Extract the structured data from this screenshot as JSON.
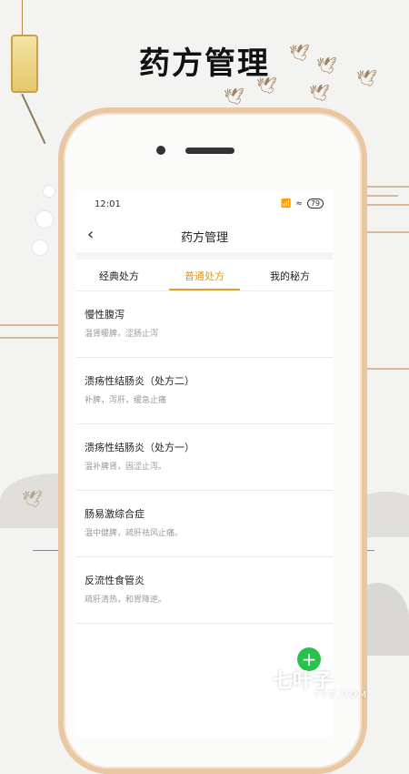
{
  "promo": {
    "title": "药方管理"
  },
  "status_bar": {
    "time": "12:01",
    "signal": "📶",
    "wifi": "≈",
    "battery": "79"
  },
  "navbar": {
    "back_icon": "‹",
    "title": "药方管理"
  },
  "tabs": [
    {
      "label": "经典处方",
      "active": false
    },
    {
      "label": "普通处方",
      "active": true
    },
    {
      "label": "我的秘方",
      "active": false
    }
  ],
  "prescriptions": [
    {
      "title": "慢性腹泻",
      "desc": "温肾暖脾，涩肠止泻"
    },
    {
      "title": "溃疡性结肠炎（处方二）",
      "desc": "补脾，泻肝，缓急止痛"
    },
    {
      "title": "溃疡性结肠炎（处方一）",
      "desc": "温补脾肾，固涩止泻。"
    },
    {
      "title": "肠易激综合症",
      "desc": "温中健脾，疏肝祛风止痛。"
    },
    {
      "title": "反流性食管炎",
      "desc": "疏肝清热，和胃降逆。"
    }
  ],
  "fab": {
    "label": "+"
  },
  "watermark": {
    "brand": "七叶子",
    "domain": "7YZ.COM"
  },
  "colors": {
    "accent": "#e09a1c",
    "fab": "#27c24c",
    "phone_frame": "#e9c7a2"
  }
}
